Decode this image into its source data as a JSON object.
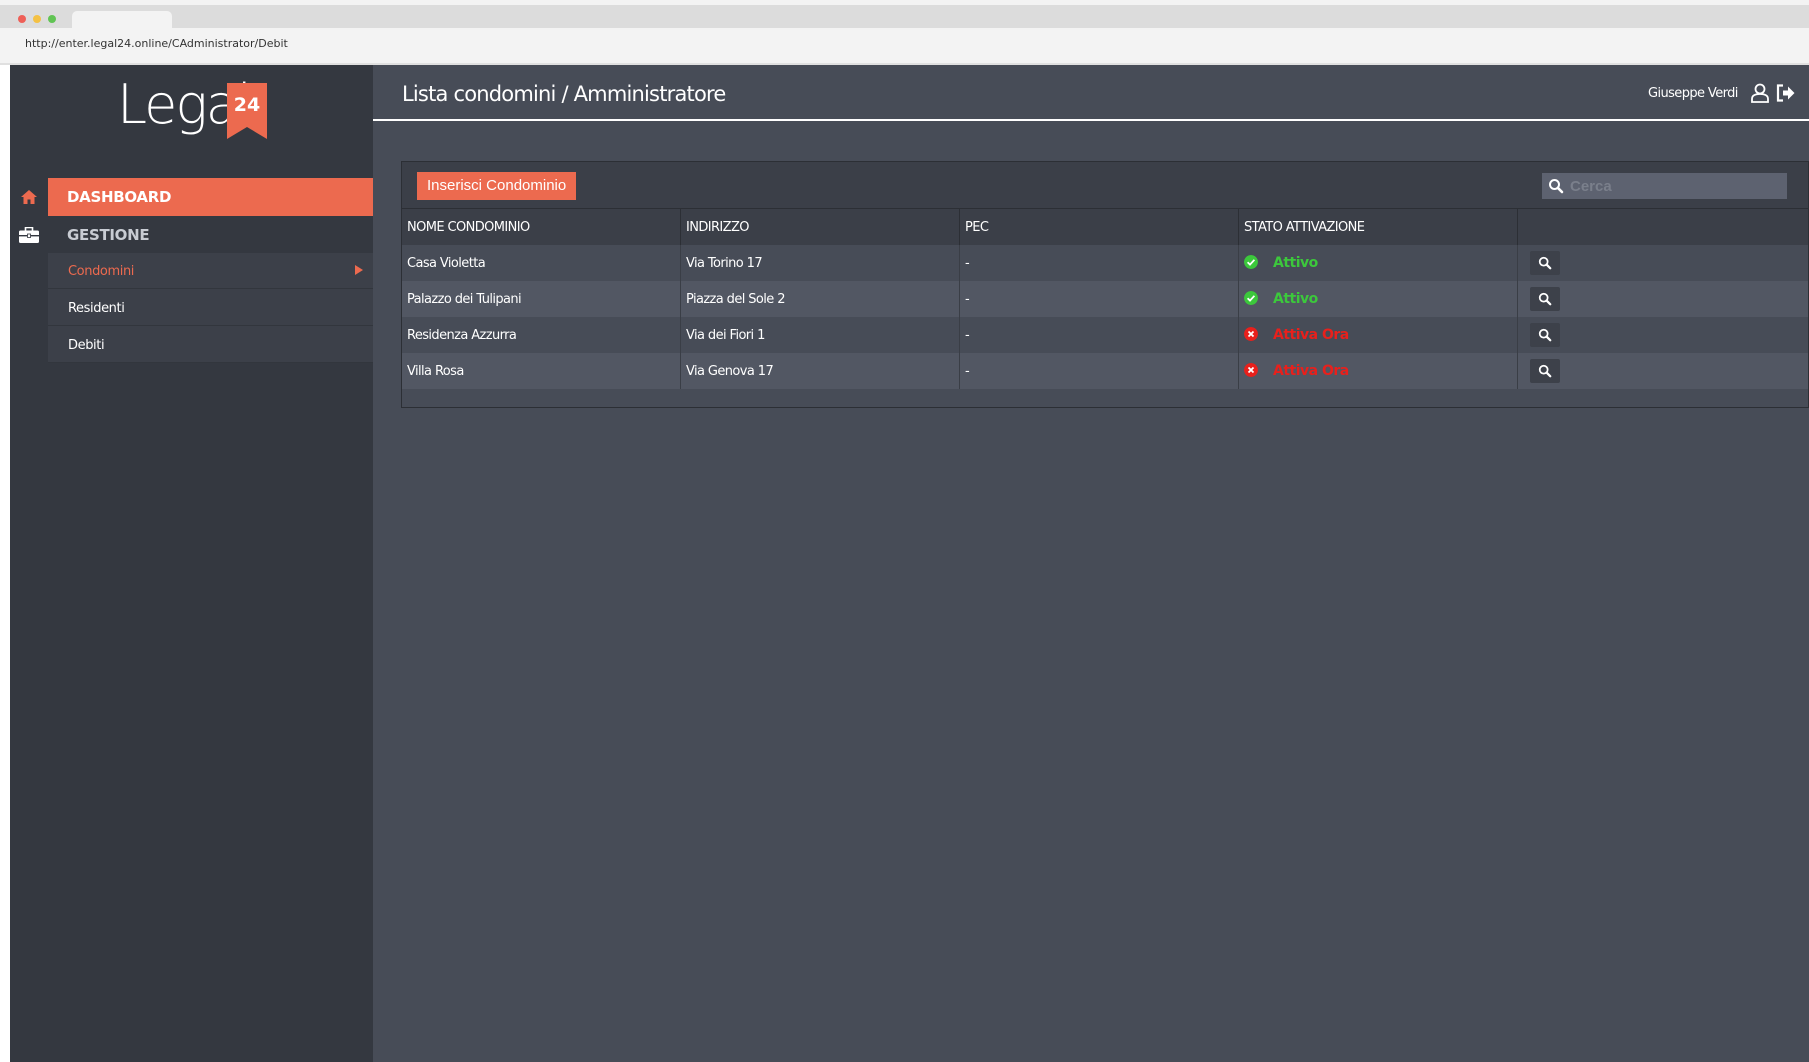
{
  "browser": {
    "url": "http://enter.legal24.online/CAdministrator/Debit"
  },
  "logo": {
    "text": "Legal",
    "badge": "24"
  },
  "sidebar": {
    "dashboard_label": "DASHBOARD",
    "gestione_label": "GESTIONE",
    "items": [
      {
        "label": "Condomini",
        "active": true
      },
      {
        "label": "Residenti",
        "active": false
      },
      {
        "label": "Debiti",
        "active": false
      }
    ]
  },
  "header": {
    "title": "Lista condomini / Amministratore",
    "user_name": "Giuseppe Verdi"
  },
  "toolbar": {
    "insert_label": "Inserisci Condominio",
    "search_placeholder": "Cerca"
  },
  "table": {
    "columns": [
      "NOME CONDOMINIO",
      "INDIRIZZO",
      "PEC",
      "STATO ATTIVAZIONE",
      ""
    ],
    "rows": [
      {
        "nome": "Casa Violetta",
        "indirizzo": "Via Torino 17",
        "pec": "-",
        "stato": "Attivo",
        "status_type": "active"
      },
      {
        "nome": "Palazzo dei Tulipani",
        "indirizzo": "Piazza del Sole 2",
        "pec": "-",
        "stato": "Attivo",
        "status_type": "active"
      },
      {
        "nome": "Residenza Azzurra",
        "indirizzo": "Via dei Fiori 1",
        "pec": "-",
        "stato": "Attiva Ora",
        "status_type": "inactive"
      },
      {
        "nome": "Villa Rosa",
        "indirizzo": "Via Genova 17",
        "pec": "-",
        "stato": "Attiva Ora",
        "status_type": "inactive"
      }
    ]
  },
  "colors": {
    "accent": "#ec6a4f",
    "active_status": "#3cc83c",
    "inactive_status": "#e8201c",
    "sidebar_bg": "#343840",
    "content_bg": "#474c57"
  },
  "icons": {
    "home": "home-icon",
    "gestione": "briefcase-icon",
    "user": "user-icon",
    "logout": "logout-icon",
    "search": "search-icon",
    "view": "magnifier-icon"
  }
}
